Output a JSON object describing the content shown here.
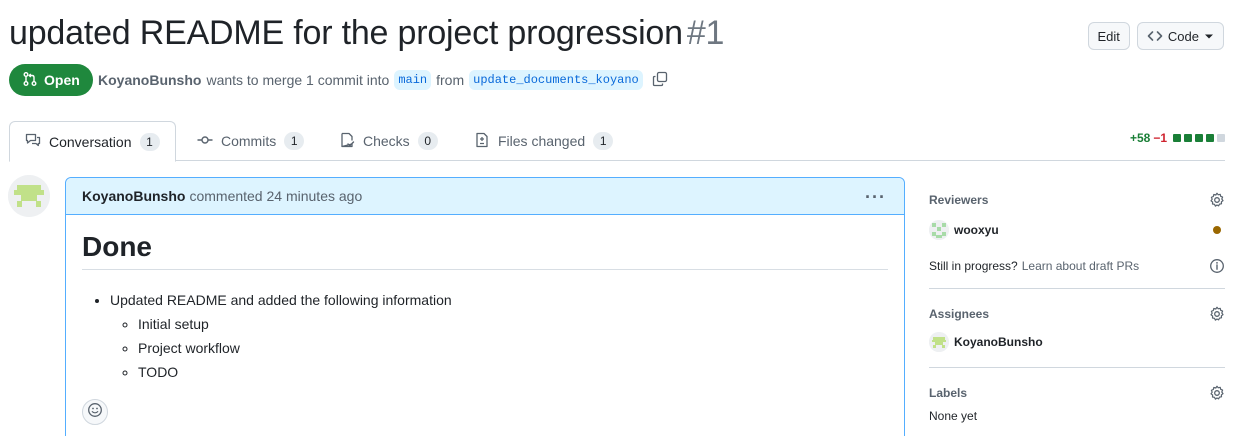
{
  "pr": {
    "title": "updated README for the project progression",
    "number": "#1",
    "state": "Open",
    "author": "KoyanoBunsho",
    "merge_text": "wants to merge 1 commit into",
    "base_branch": "main",
    "from_text": "from",
    "head_branch": "update_documents_koyano"
  },
  "header_actions": {
    "edit_label": "Edit",
    "code_label": "Code"
  },
  "tabs": [
    {
      "label": "Conversation",
      "count": "1"
    },
    {
      "label": "Commits",
      "count": "1"
    },
    {
      "label": "Checks",
      "count": "0"
    },
    {
      "label": "Files changed",
      "count": "1"
    }
  ],
  "diffstat": {
    "additions": "+58",
    "deletions": "−1",
    "add_color": "#1a7f37",
    "del_color": "#cf222e"
  },
  "comment": {
    "author": "KoyanoBunsho",
    "action": "commented",
    "time": "24 minutes ago",
    "heading": "Done",
    "item": "Updated README and added the following information",
    "subitems": [
      "Initial setup",
      "Project workflow",
      "TODO"
    ]
  },
  "sidebar": {
    "reviewers_title": "Reviewers",
    "reviewer": "wooxyu",
    "draft_question": "Still in progress?",
    "draft_link": "Learn about draft PRs",
    "assignees_title": "Assignees",
    "assignee": "KoyanoBunsho",
    "labels_title": "Labels",
    "labels_value": "None yet"
  },
  "colors": {
    "accent_open": "#1f883d",
    "comment_header_bg": "#ddf4ff",
    "link": "#0969da"
  }
}
